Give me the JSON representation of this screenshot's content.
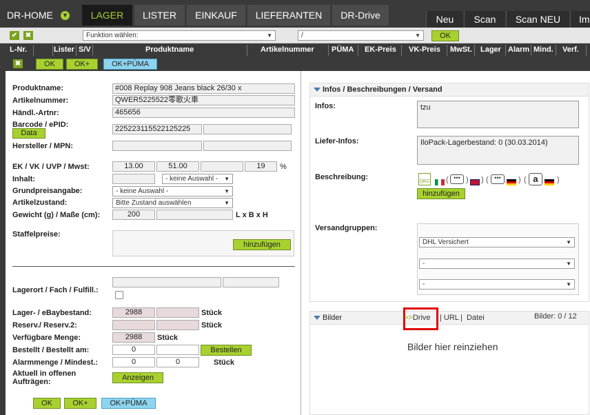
{
  "nav": {
    "home": "DR-HOME",
    "tabs": [
      "LAGER",
      "LISTER",
      "EINKAUF",
      "LIEFERANTEN",
      "DR-Drive"
    ],
    "right": [
      "Neu",
      "Scan",
      "Scan NEU",
      "Im"
    ]
  },
  "toolbar": {
    "func_select": "Funktion wählen:",
    "path_select": "/",
    "ok": "OK"
  },
  "columns": [
    "L-Nr.",
    "Lister",
    "S/V",
    "Produktname",
    "Artikelnummer",
    "PÜMA",
    "EK-Preis",
    "VK-Preis",
    "MwSt.",
    "Lager",
    "Alarm",
    "Mind.",
    "Verf."
  ],
  "actions": {
    "ok": "OK",
    "okplus": "OK+",
    "okpuma": "OK+PÜMA"
  },
  "form": {
    "produktname_label": "Produktname:",
    "produktname": "#008 Replay 908 Jeans black 26/30 x",
    "artikelnummer_label": "Artikelnummer:",
    "artikelnummer": "QWER5225522零歌火車",
    "haendl_label": "Händl.-Artnr:",
    "haendl": "465656",
    "barcode_label": "Barcode / ePID:",
    "barcode": "225223115522125225",
    "data_btn": "Data",
    "hersteller_label": "Hersteller / MPN:",
    "preise_label": "EK / VK / UVP / Mwst:",
    "ek": "13.00",
    "vk": "51.00",
    "mwst": "19",
    "pct": "%",
    "inhalt_label": "Inhalt:",
    "inhalt_sel": "- keine Auswahl -",
    "grundpreis_label": "Grundpreisangabe:",
    "grundpreis_sel": "- keine Auswahl -",
    "zustand_label": "Artikelzustand:",
    "zustand_sel": "Bitte Zustand auswählen",
    "gewicht_label": "Gewicht (g) / Maße (cm):",
    "gewicht": "200",
    "lbh": "L x B x H",
    "staffel_label": "Staffelpreise:",
    "staffel_btn": "hinzufügen",
    "lagerort_label": "Lagerort / Fach / Fulfill.:",
    "lager_label": "Lager- / eBaybestand:",
    "lager": "2988",
    "stueck": "Stück",
    "reserv_label": "Reserv./ Reserv.2:",
    "verf_label": "Verfügbare Menge:",
    "verf": "2988",
    "bestellt_label": "Bestellt / Bestellt am:",
    "bestellt": "0",
    "bestellen_btn": "Bestellen",
    "alarm_label": "Alarmmenge / Mindest.:",
    "alarm": "0",
    "mindest": "0",
    "auftraege_label": "Aktuell in offenen Aufträgen:",
    "anzeigen_btn": "Anzeigen"
  },
  "infos": {
    "title": "Infos / Beschreibungen / Versand",
    "infos_label": "Infos:",
    "infos": "tzu",
    "liefer_label": "Liefer-Infos:",
    "liefer": "IloPack-Lagerbestand: 0  (30.03.2014)",
    "beschr_label": "Beschreibung:",
    "beschr_btn": "hinzufügen",
    "versand_label": "Versandgruppen:",
    "versand1": "DHL Versichert",
    "versand2": "-",
    "versand3": "-"
  },
  "bilder": {
    "title": "Bilder",
    "drive": ">>Drive",
    "url": "URL",
    "datei": "Datei",
    "count": "Bilder: 0 / 12",
    "drop": "Bilder hier reinziehen"
  },
  "colors": {
    "accent": "#a8d130",
    "dark": "#3a3a3a",
    "highlight": "#e00000"
  }
}
